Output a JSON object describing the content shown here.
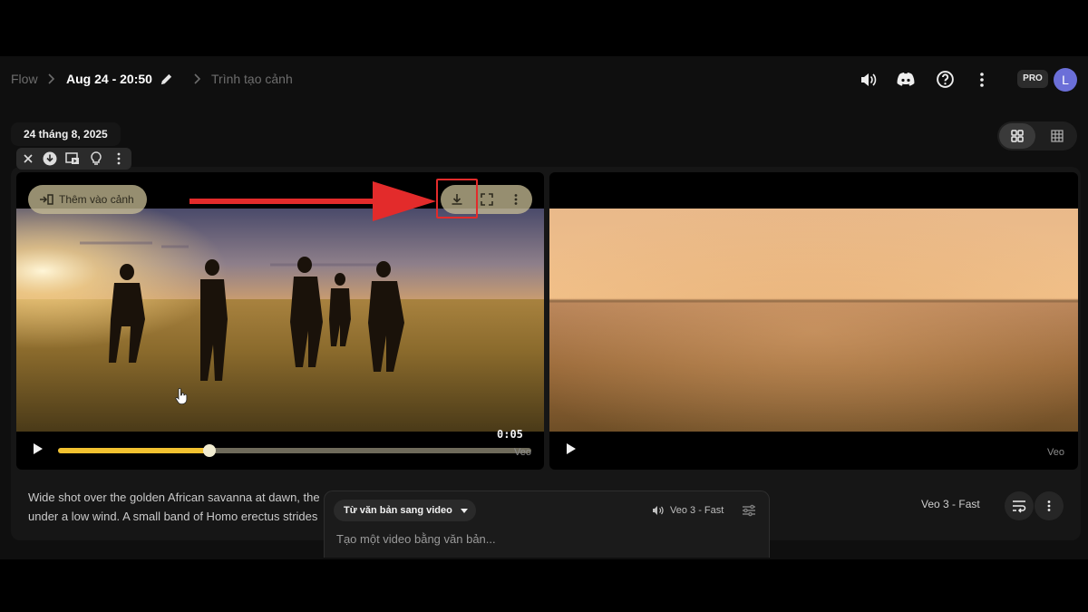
{
  "breadcrumb": {
    "root": "Flow",
    "project": "Aug 24 - 20:50",
    "current": "Trình tạo cảnh"
  },
  "account": {
    "plan": "PRO",
    "avatar_initial": "L"
  },
  "header_icons": [
    "speaker-icon",
    "discord-icon",
    "help-icon",
    "more-vert-icon"
  ],
  "view_toggle": {
    "active": "grid-2x2",
    "options": [
      "grid-2x2",
      "grid-3x3"
    ]
  },
  "date_group": "24 tháng 8, 2025",
  "selection_toolbar": [
    "close-icon",
    "download-icon",
    "add-to-scene-icon",
    "idea-icon",
    "more-vert-icon"
  ],
  "videos": [
    {
      "add_to_scene_label": "Thêm vào cảnh",
      "controls": [
        "download-icon",
        "fullscreen-icon",
        "more-vert-icon"
      ],
      "time": "0:05",
      "progress": 0.32,
      "brand": "Veo",
      "highlighted_control": "download-icon"
    },
    {
      "brand": "Veo"
    }
  ],
  "prompt_text": "Wide shot over the golden African savanna at dawn, the under a low wind. A small band of Homo erectus strides",
  "composer": {
    "mode": "Từ văn bản sang video",
    "model": "Veo 3 - Fast",
    "placeholder": "Tạo một video bằng văn bản..."
  },
  "model_label": "Veo 3 - Fast",
  "colors": {
    "accent_yellow": "#f2c230",
    "annotation_red": "#e32b2b",
    "avatar": "#6b6fd8"
  }
}
